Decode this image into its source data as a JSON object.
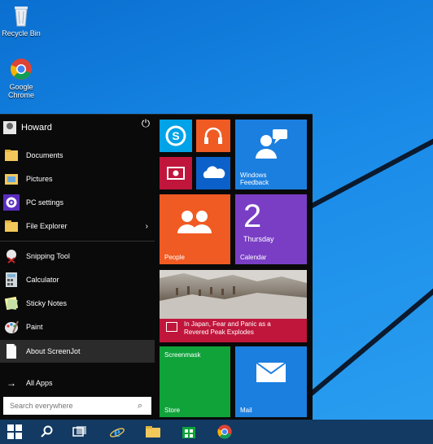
{
  "desktop": {
    "icons": [
      {
        "label": "Recycle Bin"
      },
      {
        "label": "Google Chrome"
      }
    ]
  },
  "start": {
    "user": {
      "name": "Howard"
    },
    "items": [
      {
        "label": "Documents"
      },
      {
        "label": "Pictures"
      },
      {
        "label": "PC settings"
      },
      {
        "label": "File Explorer",
        "has_arrow": true
      },
      {
        "label": "Snipping Tool"
      },
      {
        "label": "Calculator"
      },
      {
        "label": "Sticky Notes"
      },
      {
        "label": "Paint"
      },
      {
        "label": "About ScreenJot"
      },
      {
        "label": "All Apps"
      }
    ],
    "search": {
      "placeholder": "Search everywhere"
    },
    "tiles": [
      {
        "id": "skype",
        "icon": "skype-icon",
        "color": "#00a2e8"
      },
      {
        "id": "music",
        "icon": "headphones-icon",
        "color": "#f05a23"
      },
      {
        "id": "video",
        "icon": "video-icon",
        "color": "#c0163b"
      },
      {
        "id": "onedrive",
        "icon": "cloud-icon",
        "color": "#0b61c9"
      },
      {
        "id": "windows-feedback",
        "label": "Windows\nFeedback",
        "icon": "feedback-icon",
        "color": "#1b7fe0"
      },
      {
        "id": "people",
        "label": "People",
        "icon": "people-icon",
        "color": "#f05a23"
      },
      {
        "id": "calendar",
        "label": "Calendar",
        "day_number": "2",
        "day_name": "Thursday",
        "color": "#7a3ec5"
      },
      {
        "id": "news",
        "headline": "In Japan, Fear and Panic as a\nRevered Peak Explodes",
        "color": "#c0163b"
      },
      {
        "id": "store",
        "label": "Store",
        "subtitle": "Screenmask",
        "color": "#0fa33a"
      },
      {
        "id": "mail",
        "label": "Mail",
        "icon": "mail-icon",
        "color": "#1b7fe0"
      }
    ]
  },
  "taskbar": {
    "items": [
      "windows-logo-icon",
      "search-icon",
      "task-view-icon",
      "internet-explorer-icon",
      "file-explorer-icon",
      "store-icon",
      "chrome-icon"
    ]
  },
  "colors": {
    "desktop_blue": "#1a8be8",
    "start_bg": "#0a0a0a",
    "taskbar": "#123a63"
  }
}
